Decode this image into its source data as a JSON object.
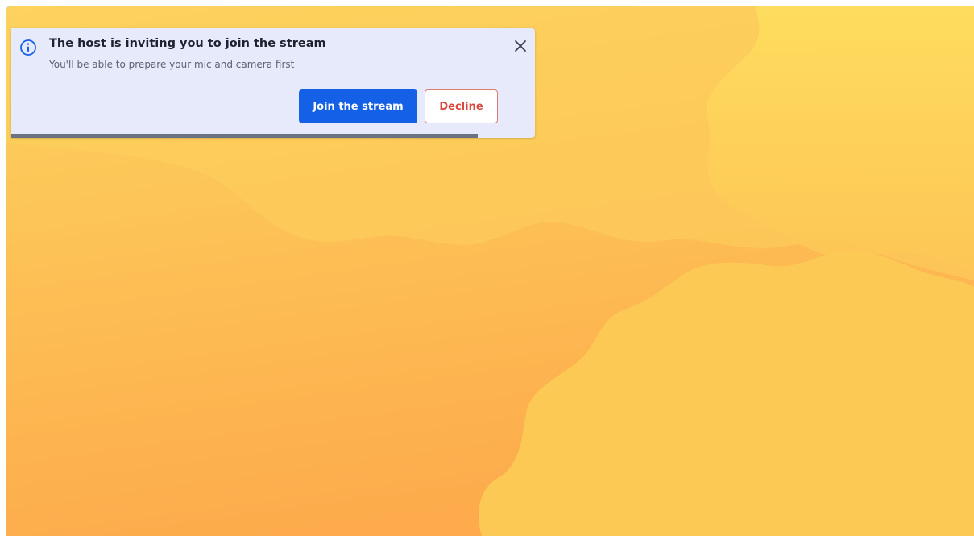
{
  "notification": {
    "title": "The host is inviting you to join the stream",
    "subtitle": "You'll be able to prepare your mic and camera first",
    "primary_button": "Join the stream",
    "secondary_button": "Decline",
    "progress_fraction": 0.89,
    "icons": {
      "info": "info-icon",
      "close": "close-icon"
    }
  },
  "colors": {
    "toast_background": "#e6eafa",
    "primary_button": "#1460e6",
    "decline_text": "#d9473f",
    "progress_bar": "#6b7382",
    "stage_top": "#fdd45e",
    "stage_bottom": "#fdab4c"
  }
}
